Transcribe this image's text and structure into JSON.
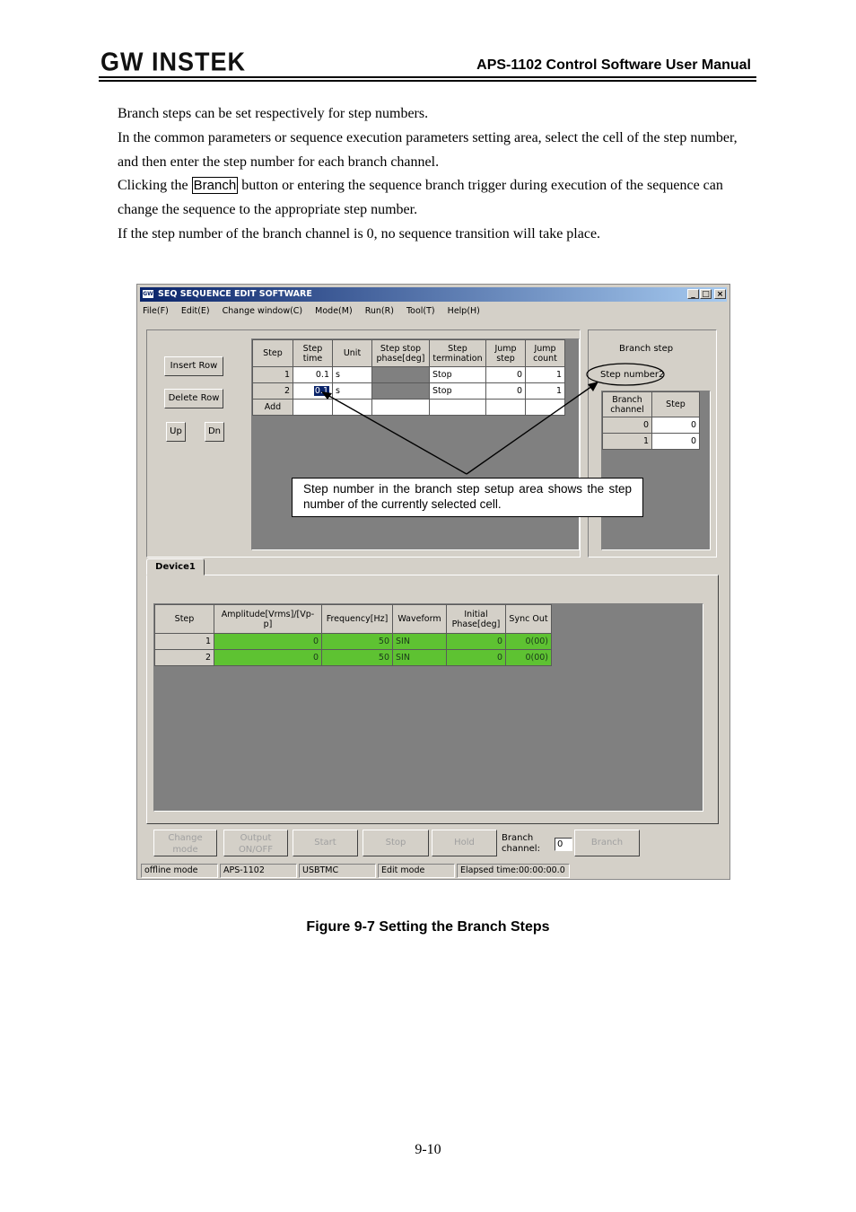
{
  "header": {
    "logo": "GW INSTEK",
    "title": "APS-1102 Control Software User Manual"
  },
  "body": {
    "p1": "Branch steps can be set respectively for step numbers.",
    "p2": "In the common parameters or sequence execution parameters setting area, select the cell of the step number, and then enter the step number for each branch channel.",
    "p3_before": "Clicking the ",
    "p3_button": "Branch",
    "p3_after": " button or entering the sequence branch trigger during execution of the sequence can change the sequence to the appropriate step number.",
    "p4": "If the step number of the branch channel is 0, no sequence transition will take place."
  },
  "app": {
    "title": "SEQ SEQUENCE EDIT SOFTWARE",
    "window_buttons": {
      "minimize": "_",
      "maximize": "□",
      "close": "×"
    },
    "menu": [
      "File(F)",
      "Edit(E)",
      "Change window(C)",
      "Mode(M)",
      "Run(R)",
      "Tool(T)",
      "Help(H)"
    ],
    "left_buttons": {
      "insert_row": "Insert Row",
      "delete_row": "Delete Row",
      "up": "Up",
      "dn": "Dn"
    },
    "seq_table": {
      "headers": [
        "Step",
        "Step time",
        "Unit",
        "Step stop phase[deg]",
        "Step termination",
        "Jump step",
        "Jump count"
      ],
      "header_lines": [
        [
          "Step"
        ],
        [
          "Step",
          "time"
        ],
        [
          "Unit"
        ],
        [
          "Step stop",
          "phase[deg]"
        ],
        [
          "Step",
          "termination"
        ],
        [
          "Jump",
          "step"
        ],
        [
          "Jump",
          "count"
        ]
      ],
      "rows": [
        {
          "step": "1",
          "time": "0.1",
          "unit": "s",
          "phase": "",
          "termination": "Stop",
          "jump_step": "0",
          "jump_count": "1"
        },
        {
          "step": "2",
          "time": "0.1",
          "unit": "s",
          "phase": "",
          "termination": "Stop",
          "jump_step": "0",
          "jump_count": "1"
        }
      ],
      "add_label": "Add"
    },
    "branch_step": {
      "title": "Branch step",
      "step_number_label": "Step number2",
      "headers": [
        "Branch channel",
        "Step"
      ],
      "header_lines": [
        [
          "Branch",
          "channel"
        ],
        [
          "Step"
        ]
      ],
      "rows": [
        {
          "channel": "0",
          "step": "0"
        },
        {
          "channel": "1",
          "step": "0"
        }
      ]
    },
    "callout": "Step number in the branch step setup area shows the step number of the currently selected cell.",
    "device_tab": "Device1",
    "device_table": {
      "headers": [
        "Step",
        "Amplitude[Vrms]/[Vp-p]",
        "Frequency[Hz]",
        "Waveform",
        "Initial Phase[deg]",
        "Sync Out"
      ],
      "header_lines": [
        [
          "Step"
        ],
        [
          "Amplitude[Vrms]/[Vp-p]"
        ],
        [
          "Frequency[Hz]"
        ],
        [
          "Waveform"
        ],
        [
          "Initial",
          "Phase[deg]"
        ],
        [
          "Sync Out"
        ]
      ],
      "rows": [
        {
          "step": "1",
          "amplitude": "0",
          "frequency": "50",
          "waveform": "SIN",
          "phase": "0",
          "sync": "0(00)"
        },
        {
          "step": "2",
          "amplitude": "0",
          "frequency": "50",
          "waveform": "SIN",
          "phase": "0",
          "sync": "0(00)"
        }
      ],
      "highlight_color": "#5ec232"
    },
    "bottom_buttons": {
      "change_mode": "Change mode",
      "output_onoff": "Output ON/OFF",
      "start": "Start",
      "stop": "Stop",
      "hold": "Hold",
      "branch_channel_label": "Branch channel:",
      "branch_channel_value": "0",
      "branch": "Branch"
    },
    "status_bar": [
      "offline mode",
      "APS-1102",
      "USBTMC",
      "Edit mode",
      "Elapsed time:00:00:00.0"
    ]
  },
  "caption": "Figure 9-7 Setting the Branch Steps",
  "page_number": "9-10"
}
